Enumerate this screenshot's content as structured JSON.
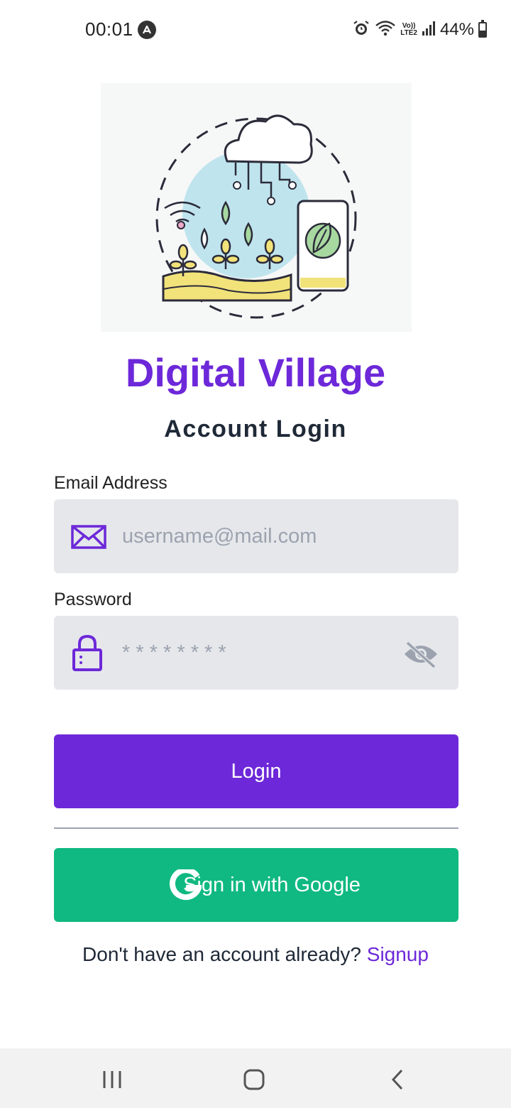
{
  "status_bar": {
    "time": "00:01",
    "network_label": "LTE2",
    "battery_percent": "44%",
    "battery_level": 0.44
  },
  "app": {
    "title": "Digital Village",
    "subtitle": "Account Login"
  },
  "form": {
    "email": {
      "label": "Email Address",
      "placeholder": "username@mail.com",
      "value": ""
    },
    "password": {
      "label": "Password",
      "placeholder": "* * * * * * * *",
      "value": ""
    },
    "login_label": "Login",
    "google_label": "Sign in with Google",
    "signup_prompt": "Don't have an account already?",
    "signup_link": "Signup"
  },
  "colors": {
    "primary": "#6d28d9",
    "google_button": "#10b981",
    "field_bg": "#e5e7eb"
  },
  "icons": {
    "email": "envelope-icon",
    "password": "lock-icon",
    "toggle_password": "eye-off-icon",
    "google": "google-g-icon"
  }
}
